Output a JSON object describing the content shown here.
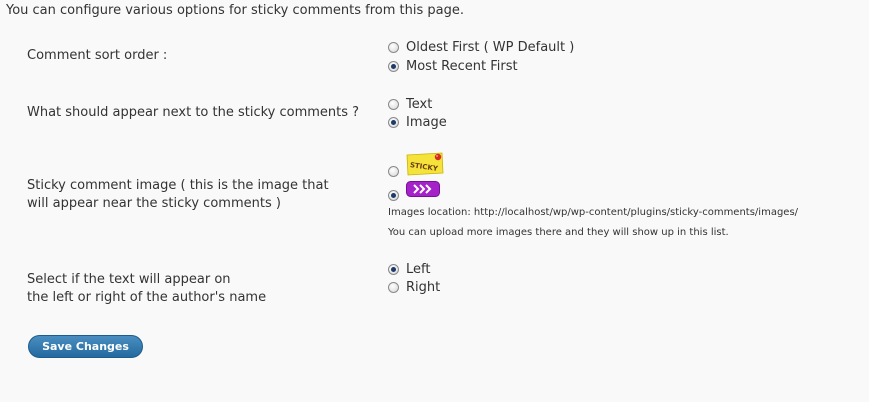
{
  "intro": "You can configure various options for sticky comments from this page.",
  "sort_order": {
    "label": "Comment sort order :",
    "options": [
      "Oldest First ( WP Default )",
      "Most Recent First"
    ],
    "selected": 1
  },
  "next_to": {
    "label": "What should appear next to the sticky comments ?",
    "options": [
      "Text",
      "Image"
    ],
    "selected": 1
  },
  "sticky_image": {
    "label_line1": "Sticky comment image ( this is the image that",
    "label_line2": "will appear near the sticky comments )",
    "sticky_text": "STICKY",
    "location": "Images location: http://localhost/wp/wp-content/plugins/sticky-comments/images/",
    "note": "You can upload more images there and they will show up in this list.",
    "selected": 1
  },
  "position": {
    "label_line1": "Select if the text will appear on",
    "label_line2": "the left or right of the author's name",
    "options": [
      "Left",
      "Right"
    ],
    "selected": 0
  },
  "save_label": "Save Changes"
}
